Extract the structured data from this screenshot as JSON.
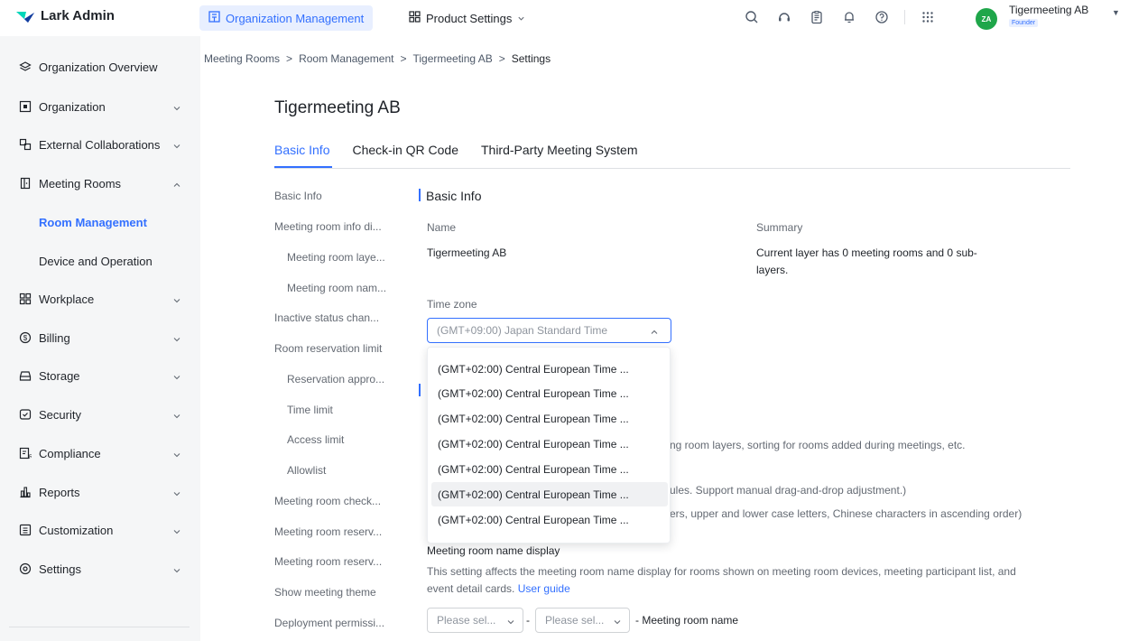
{
  "brand": {
    "name": "Lark Admin",
    "colors": {
      "accent": "#3370ff",
      "avatar": "#1fa64a"
    }
  },
  "header": {
    "tabs": [
      {
        "label": "Organization Management",
        "icon": "org-chart-icon"
      },
      {
        "label": "Product Settings",
        "icon": "product-settings-icon"
      }
    ],
    "icons": [
      "search-icon",
      "support-icon",
      "notes-icon",
      "bell-icon",
      "help-icon",
      "apps-grid-icon"
    ],
    "user": {
      "initials": "ZA",
      "name": "Tigermeeting AB",
      "role": "Founder"
    }
  },
  "sidebar": {
    "items": [
      {
        "label": "Organization Overview",
        "icon": "layers-icon"
      },
      {
        "label": "Organization",
        "icon": "org-icon"
      },
      {
        "label": "External Collaborations",
        "icon": "external-icon"
      },
      {
        "label": "Meeting Rooms",
        "icon": "door-icon"
      },
      {
        "label": "Workplace",
        "icon": "grid-icon"
      },
      {
        "label": "Billing",
        "icon": "billing-icon"
      },
      {
        "label": "Storage",
        "icon": "storage-icon"
      },
      {
        "label": "Security",
        "icon": "shield-icon"
      },
      {
        "label": "Compliance",
        "icon": "compliance-icon"
      },
      {
        "label": "Reports",
        "icon": "reports-icon"
      },
      {
        "label": "Customization",
        "icon": "customization-icon"
      },
      {
        "label": "Settings",
        "icon": "settings-icon"
      }
    ],
    "subitems": [
      {
        "label": "Room Management"
      },
      {
        "label": "Device and Operation"
      }
    ]
  },
  "breadcrumb": [
    "Meeting Rooms",
    "Room Management",
    "Tigermeeting AB",
    "Settings"
  ],
  "page": {
    "title": "Tigermeeting AB",
    "tabs": [
      "Basic Info",
      "Check-in QR Code",
      "Third-Party Meeting System"
    ]
  },
  "anchors": [
    "Basic Info",
    "Meeting room info di...",
    "Meeting room laye...",
    "Meeting room nam...",
    "Inactive status chan...",
    "Room reservation limit",
    "Reservation appro...",
    "Time limit",
    "Access limit",
    "Allowlist",
    "Meeting room check...",
    "Meeting room reserv...",
    "Meeting room reserv...",
    "Show meeting theme",
    "Deployment permissi..."
  ],
  "basic_info": {
    "section_title": "Basic Info",
    "name_label": "Name",
    "name_value": "Tigermeeting AB",
    "summary_label": "Summary",
    "summary_line1": "Current layer has 0 meeting rooms and 0 sub-",
    "summary_line2": "layers.",
    "timezone_label": "Time zone",
    "timezone_value": "(GMT+09:00) Japan Standard Time"
  },
  "timezone_options": [
    "(GMT+02:00) Central European Time ...",
    "(GMT+02:00) Central European Time ...",
    "(GMT+02:00) Central European Time ...",
    "(GMT+02:00) Central European Time ...",
    "(GMT+02:00) Central European Time ...",
    "(GMT+02:00) Central European Time ...",
    "(GMT+02:00) Central European Time ..."
  ],
  "hidden_texts": {
    "line1": "ng room layers, sorting for rooms added during meetings, etc.",
    "line2": "ules. Support manual drag-and-drop adjustment.)",
    "line3": "ers, upper and lower case letters, Chinese characters in ascending order)"
  },
  "name_display": {
    "title": "Meeting room name display",
    "desc1": "This setting affects the meeting room name display for rooms shown on meeting room devices, meeting participant list, and",
    "desc2": "event detail cards.",
    "link": "User guide",
    "select1": "Please sel...",
    "dash": "-",
    "select2": "Please sel...",
    "suffix": "- Meeting room name"
  }
}
